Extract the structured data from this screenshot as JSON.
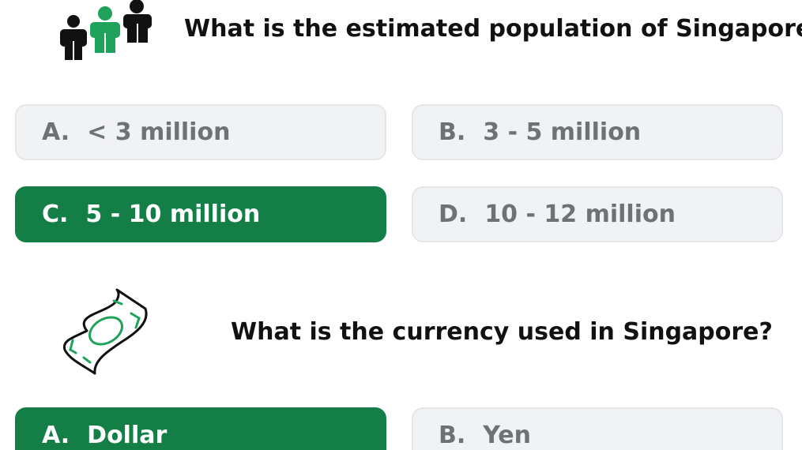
{
  "questions": [
    {
      "icon": "people-icon",
      "text": "What is the estimated population of Singapore?",
      "options": [
        {
          "letter": "A.",
          "label": "< 3 million",
          "selected": false
        },
        {
          "letter": "B.",
          "label": "3 - 5 million",
          "selected": false
        },
        {
          "letter": "C.",
          "label": "5 - 10 million",
          "selected": true
        },
        {
          "letter": "D.",
          "label": "10 - 12 million",
          "selected": false
        }
      ]
    },
    {
      "icon": "banknote-icon",
      "text": "What is the currency used in Singapore?",
      "options": [
        {
          "letter": "A.",
          "label": "Dollar",
          "selected": true
        },
        {
          "letter": "B.",
          "label": "Yen",
          "selected": false
        }
      ]
    }
  ],
  "colors": {
    "selected_bg": "#137f46",
    "option_bg": "#f1f2f4",
    "option_text": "#6f7275",
    "accent_green": "#1fa35b"
  }
}
